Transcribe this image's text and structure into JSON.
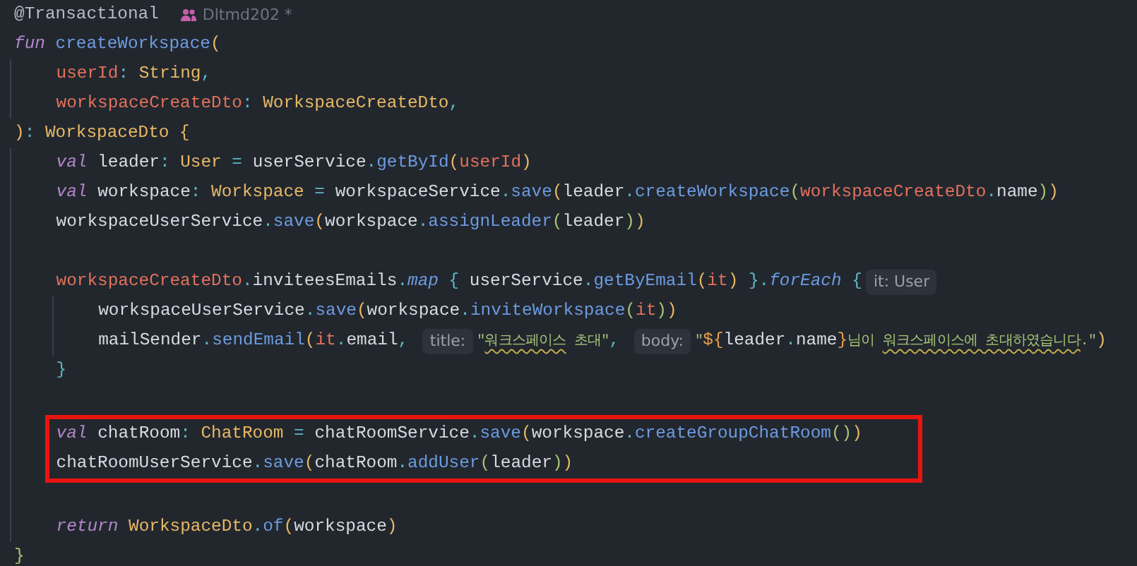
{
  "editor": {
    "lines": [
      {
        "kind": "code",
        "tokens": [
          {
            "text": "@Transactional",
            "kind": "annotation"
          },
          {
            "text": "Dltmd202 *",
            "kind": "author"
          }
        ]
      },
      {
        "kind": "code",
        "tokens": [
          {
            "text": "fun ",
            "kind": "keyword"
          },
          {
            "text": "createWorkspace",
            "kind": "function"
          },
          {
            "text": "(",
            "kind": "paren1"
          }
        ],
        "children": [
          {
            "kind": "code",
            "tokens": [
              {
                "text": "userId",
                "kind": "parameter"
              },
              {
                "text": ": ",
                "kind": "punct"
              },
              {
                "text": "String",
                "kind": "type"
              },
              {
                "text": ",",
                "kind": "punct"
              }
            ]
          },
          {
            "kind": "code",
            "tokens": [
              {
                "text": "workspaceCreateDto",
                "kind": "parameter"
              },
              {
                "text": ": ",
                "kind": "punct"
              },
              {
                "text": "WorkspaceCreateDto",
                "kind": "type"
              },
              {
                "text": ",",
                "kind": "punct"
              }
            ]
          }
        ]
      },
      {
        "kind": "code",
        "tokens": [
          {
            "text": ")",
            "kind": "paren1"
          },
          {
            "text": ": ",
            "kind": "punct"
          },
          {
            "text": "WorkspaceDto",
            "kind": "type"
          },
          {
            "text": " {",
            "kind": "paren1"
          }
        ],
        "children": [
          {
            "kind": "code",
            "tokens": [
              {
                "text": "val",
                "kind": "keyword"
              },
              {
                "text": " leader",
                "kind": "plain"
              },
              {
                "text": ": ",
                "kind": "punct"
              },
              {
                "text": "User",
                "kind": "type"
              },
              {
                "text": " = ",
                "kind": "punct"
              },
              {
                "text": "userService",
                "kind": "plain"
              },
              {
                "text": ".",
                "kind": "punct"
              },
              {
                "text": "getById",
                "kind": "function"
              },
              {
                "text": "(",
                "kind": "paren1"
              },
              {
                "text": "userId",
                "kind": "parameter"
              },
              {
                "text": ")",
                "kind": "paren1"
              }
            ]
          },
          {
            "kind": "code",
            "tokens": [
              {
                "text": "val",
                "kind": "keyword"
              },
              {
                "text": " workspace",
                "kind": "plain"
              },
              {
                "text": ": ",
                "kind": "punct"
              },
              {
                "text": "Workspace",
                "kind": "type"
              },
              {
                "text": " = ",
                "kind": "punct"
              },
              {
                "text": "workspaceService",
                "kind": "plain"
              },
              {
                "text": ".",
                "kind": "punct"
              },
              {
                "text": "save",
                "kind": "function"
              },
              {
                "text": "(",
                "kind": "paren1"
              },
              {
                "text": "leader",
                "kind": "plain"
              },
              {
                "text": ".",
                "kind": "punct"
              },
              {
                "text": "createWorkspace",
                "kind": "function"
              },
              {
                "text": "(",
                "kind": "paren2"
              },
              {
                "text": "workspaceCreateDto",
                "kind": "parameter"
              },
              {
                "text": ".",
                "kind": "punct"
              },
              {
                "text": "name",
                "kind": "plain"
              },
              {
                "text": ")",
                "kind": "paren2"
              },
              {
                "text": ")",
                "kind": "paren1"
              }
            ]
          },
          {
            "kind": "code",
            "tokens": [
              {
                "text": "workspaceUserService",
                "kind": "plain"
              },
              {
                "text": ".",
                "kind": "punct"
              },
              {
                "text": "save",
                "kind": "function"
              },
              {
                "text": "(",
                "kind": "paren1"
              },
              {
                "text": "workspace",
                "kind": "plain"
              },
              {
                "text": ".",
                "kind": "punct"
              },
              {
                "text": "assignLeader",
                "kind": "function"
              },
              {
                "text": "(",
                "kind": "paren2"
              },
              {
                "text": "leader",
                "kind": "plain"
              },
              {
                "text": ")",
                "kind": "paren2"
              },
              {
                "text": ")",
                "kind": "paren1"
              }
            ]
          },
          {
            "kind": "blank"
          },
          {
            "kind": "code",
            "tokens": [
              {
                "text": "workspaceCreateDto",
                "kind": "parameter"
              },
              {
                "text": ".",
                "kind": "punct"
              },
              {
                "text": "inviteesEmails",
                "kind": "plain"
              },
              {
                "text": ".",
                "kind": "punct"
              },
              {
                "text": "map",
                "kind": "extension"
              },
              {
                "text": " { ",
                "kind": "brace"
              },
              {
                "text": "userService",
                "kind": "plain"
              },
              {
                "text": ".",
                "kind": "punct"
              },
              {
                "text": "getByEmail",
                "kind": "function"
              },
              {
                "text": "(",
                "kind": "paren1"
              },
              {
                "text": "it",
                "kind": "parameter"
              },
              {
                "text": ")",
                "kind": "paren1"
              },
              {
                "text": " }",
                "kind": "brace"
              },
              {
                "text": ".",
                "kind": "punct"
              },
              {
                "text": "forEach",
                "kind": "extension"
              },
              {
                "text": " {",
                "kind": "brace"
              },
              {
                "text": "it: User",
                "kind": "hint"
              }
            ],
            "children": [
              {
                "kind": "code",
                "tokens": [
                  {
                    "text": "workspaceUserService",
                    "kind": "plain"
                  },
                  {
                    "text": ".",
                    "kind": "punct"
                  },
                  {
                    "text": "save",
                    "kind": "function"
                  },
                  {
                    "text": "(",
                    "kind": "paren1"
                  },
                  {
                    "text": "workspace",
                    "kind": "plain"
                  },
                  {
                    "text": ".",
                    "kind": "punct"
                  },
                  {
                    "text": "inviteWorkspace",
                    "kind": "function"
                  },
                  {
                    "text": "(",
                    "kind": "paren2"
                  },
                  {
                    "text": "it",
                    "kind": "parameter"
                  },
                  {
                    "text": ")",
                    "kind": "paren2"
                  },
                  {
                    "text": ")",
                    "kind": "paren1"
                  }
                ]
              },
              {
                "kind": "code",
                "tokens": [
                  {
                    "text": "mailSender",
                    "kind": "plain"
                  },
                  {
                    "text": ".",
                    "kind": "punct"
                  },
                  {
                    "text": "sendEmail",
                    "kind": "function"
                  },
                  {
                    "text": "(",
                    "kind": "paren1"
                  },
                  {
                    "text": "it",
                    "kind": "parameter"
                  },
                  {
                    "text": ".",
                    "kind": "punct"
                  },
                  {
                    "text": "email",
                    "kind": "plain"
                  },
                  {
                    "text": ", ",
                    "kind": "punct"
                  },
                  {
                    "text": "title:",
                    "kind": "hint"
                  },
                  {
                    "text": "\"",
                    "kind": "string"
                  },
                  {
                    "text": "워크스페이스",
                    "kind": "string",
                    "squiggly": true
                  },
                  {
                    "text": " 초대\"",
                    "kind": "string"
                  },
                  {
                    "text": ", ",
                    "kind": "punct"
                  },
                  {
                    "text": "body:",
                    "kind": "hint"
                  },
                  {
                    "text": "\"",
                    "kind": "string"
                  },
                  {
                    "text": "${",
                    "kind": "template"
                  },
                  {
                    "text": "leader",
                    "kind": "plain"
                  },
                  {
                    "text": ".",
                    "kind": "punct"
                  },
                  {
                    "text": "name",
                    "kind": "plain"
                  },
                  {
                    "text": "}",
                    "kind": "template"
                  },
                  {
                    "text": "님이 ",
                    "kind": "string"
                  },
                  {
                    "text": "워크스페이스에 초대하였습니다",
                    "kind": "string",
                    "squiggly": true
                  },
                  {
                    "text": ".\"",
                    "kind": "string"
                  },
                  {
                    "text": ")",
                    "kind": "paren1"
                  }
                ]
              }
            ]
          },
          {
            "kind": "code",
            "tokens": [
              {
                "text": "}",
                "kind": "brace"
              }
            ]
          },
          {
            "kind": "blank"
          },
          {
            "kind": "code",
            "highlighted": true,
            "tokens": [
              {
                "text": "val",
                "kind": "keyword"
              },
              {
                "text": " chatRoom",
                "kind": "plain"
              },
              {
                "text": ": ",
                "kind": "punct"
              },
              {
                "text": "ChatRoom",
                "kind": "type"
              },
              {
                "text": " = ",
                "kind": "punct"
              },
              {
                "text": "chatRoomService",
                "kind": "plain"
              },
              {
                "text": ".",
                "kind": "punct"
              },
              {
                "text": "save",
                "kind": "function"
              },
              {
                "text": "(",
                "kind": "paren1"
              },
              {
                "text": "workspace",
                "kind": "plain"
              },
              {
                "text": ".",
                "kind": "punct"
              },
              {
                "text": "createGroupChatRoom",
                "kind": "function"
              },
              {
                "text": "()",
                "kind": "paren2"
              },
              {
                "text": ")",
                "kind": "paren1"
              }
            ]
          },
          {
            "kind": "code",
            "highlighted": true,
            "tokens": [
              {
                "text": "chatRoomUserService",
                "kind": "plain"
              },
              {
                "text": ".",
                "kind": "punct"
              },
              {
                "text": "save",
                "kind": "function"
              },
              {
                "text": "(",
                "kind": "paren1"
              },
              {
                "text": "chatRoom",
                "kind": "plain"
              },
              {
                "text": ".",
                "kind": "punct"
              },
              {
                "text": "addUser",
                "kind": "function"
              },
              {
                "text": "(",
                "kind": "paren2"
              },
              {
                "text": "leader",
                "kind": "plain"
              },
              {
                "text": ")",
                "kind": "paren2"
              },
              {
                "text": ")",
                "kind": "paren1"
              }
            ]
          },
          {
            "kind": "blank"
          },
          {
            "kind": "code",
            "tokens": [
              {
                "text": "return ",
                "kind": "keyword"
              },
              {
                "text": "WorkspaceDto",
                "kind": "type"
              },
              {
                "text": ".",
                "kind": "punct"
              },
              {
                "text": "of",
                "kind": "function"
              },
              {
                "text": "(",
                "kind": "paren1"
              },
              {
                "text": "workspace",
                "kind": "plain"
              },
              {
                "text": ")",
                "kind": "paren1"
              }
            ]
          }
        ]
      },
      {
        "kind": "code",
        "tokens": [
          {
            "text": "}",
            "kind": "paren3"
          }
        ]
      }
    ]
  }
}
